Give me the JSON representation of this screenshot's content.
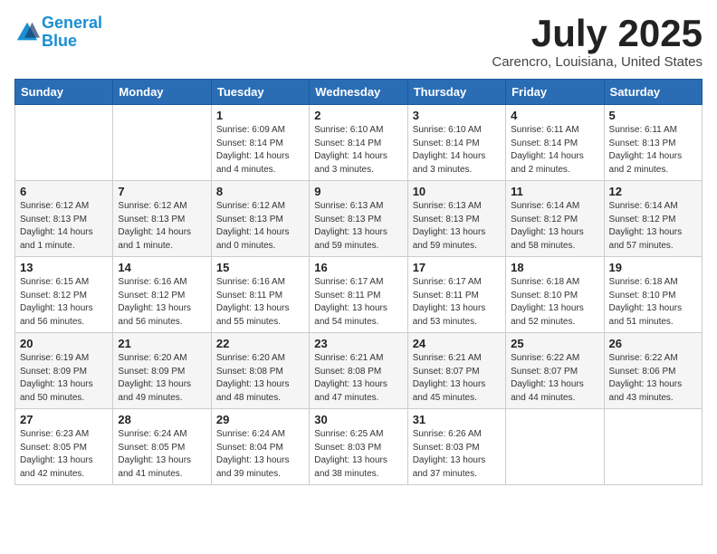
{
  "header": {
    "logo_line1": "General",
    "logo_line2": "Blue",
    "month_title": "July 2025",
    "location": "Carencro, Louisiana, United States"
  },
  "days_of_week": [
    "Sunday",
    "Monday",
    "Tuesday",
    "Wednesday",
    "Thursday",
    "Friday",
    "Saturday"
  ],
  "weeks": [
    [
      {
        "day": "",
        "content": ""
      },
      {
        "day": "",
        "content": ""
      },
      {
        "day": "1",
        "content": "Sunrise: 6:09 AM\nSunset: 8:14 PM\nDaylight: 14 hours and 4 minutes."
      },
      {
        "day": "2",
        "content": "Sunrise: 6:10 AM\nSunset: 8:14 PM\nDaylight: 14 hours and 3 minutes."
      },
      {
        "day": "3",
        "content": "Sunrise: 6:10 AM\nSunset: 8:14 PM\nDaylight: 14 hours and 3 minutes."
      },
      {
        "day": "4",
        "content": "Sunrise: 6:11 AM\nSunset: 8:14 PM\nDaylight: 14 hours and 2 minutes."
      },
      {
        "day": "5",
        "content": "Sunrise: 6:11 AM\nSunset: 8:13 PM\nDaylight: 14 hours and 2 minutes."
      }
    ],
    [
      {
        "day": "6",
        "content": "Sunrise: 6:12 AM\nSunset: 8:13 PM\nDaylight: 14 hours and 1 minute."
      },
      {
        "day": "7",
        "content": "Sunrise: 6:12 AM\nSunset: 8:13 PM\nDaylight: 14 hours and 1 minute."
      },
      {
        "day": "8",
        "content": "Sunrise: 6:12 AM\nSunset: 8:13 PM\nDaylight: 14 hours and 0 minutes."
      },
      {
        "day": "9",
        "content": "Sunrise: 6:13 AM\nSunset: 8:13 PM\nDaylight: 13 hours and 59 minutes."
      },
      {
        "day": "10",
        "content": "Sunrise: 6:13 AM\nSunset: 8:13 PM\nDaylight: 13 hours and 59 minutes."
      },
      {
        "day": "11",
        "content": "Sunrise: 6:14 AM\nSunset: 8:12 PM\nDaylight: 13 hours and 58 minutes."
      },
      {
        "day": "12",
        "content": "Sunrise: 6:14 AM\nSunset: 8:12 PM\nDaylight: 13 hours and 57 minutes."
      }
    ],
    [
      {
        "day": "13",
        "content": "Sunrise: 6:15 AM\nSunset: 8:12 PM\nDaylight: 13 hours and 56 minutes."
      },
      {
        "day": "14",
        "content": "Sunrise: 6:16 AM\nSunset: 8:12 PM\nDaylight: 13 hours and 56 minutes."
      },
      {
        "day": "15",
        "content": "Sunrise: 6:16 AM\nSunset: 8:11 PM\nDaylight: 13 hours and 55 minutes."
      },
      {
        "day": "16",
        "content": "Sunrise: 6:17 AM\nSunset: 8:11 PM\nDaylight: 13 hours and 54 minutes."
      },
      {
        "day": "17",
        "content": "Sunrise: 6:17 AM\nSunset: 8:11 PM\nDaylight: 13 hours and 53 minutes."
      },
      {
        "day": "18",
        "content": "Sunrise: 6:18 AM\nSunset: 8:10 PM\nDaylight: 13 hours and 52 minutes."
      },
      {
        "day": "19",
        "content": "Sunrise: 6:18 AM\nSunset: 8:10 PM\nDaylight: 13 hours and 51 minutes."
      }
    ],
    [
      {
        "day": "20",
        "content": "Sunrise: 6:19 AM\nSunset: 8:09 PM\nDaylight: 13 hours and 50 minutes."
      },
      {
        "day": "21",
        "content": "Sunrise: 6:20 AM\nSunset: 8:09 PM\nDaylight: 13 hours and 49 minutes."
      },
      {
        "day": "22",
        "content": "Sunrise: 6:20 AM\nSunset: 8:08 PM\nDaylight: 13 hours and 48 minutes."
      },
      {
        "day": "23",
        "content": "Sunrise: 6:21 AM\nSunset: 8:08 PM\nDaylight: 13 hours and 47 minutes."
      },
      {
        "day": "24",
        "content": "Sunrise: 6:21 AM\nSunset: 8:07 PM\nDaylight: 13 hours and 45 minutes."
      },
      {
        "day": "25",
        "content": "Sunrise: 6:22 AM\nSunset: 8:07 PM\nDaylight: 13 hours and 44 minutes."
      },
      {
        "day": "26",
        "content": "Sunrise: 6:22 AM\nSunset: 8:06 PM\nDaylight: 13 hours and 43 minutes."
      }
    ],
    [
      {
        "day": "27",
        "content": "Sunrise: 6:23 AM\nSunset: 8:05 PM\nDaylight: 13 hours and 42 minutes."
      },
      {
        "day": "28",
        "content": "Sunrise: 6:24 AM\nSunset: 8:05 PM\nDaylight: 13 hours and 41 minutes."
      },
      {
        "day": "29",
        "content": "Sunrise: 6:24 AM\nSunset: 8:04 PM\nDaylight: 13 hours and 39 minutes."
      },
      {
        "day": "30",
        "content": "Sunrise: 6:25 AM\nSunset: 8:03 PM\nDaylight: 13 hours and 38 minutes."
      },
      {
        "day": "31",
        "content": "Sunrise: 6:26 AM\nSunset: 8:03 PM\nDaylight: 13 hours and 37 minutes."
      },
      {
        "day": "",
        "content": ""
      },
      {
        "day": "",
        "content": ""
      }
    ]
  ]
}
